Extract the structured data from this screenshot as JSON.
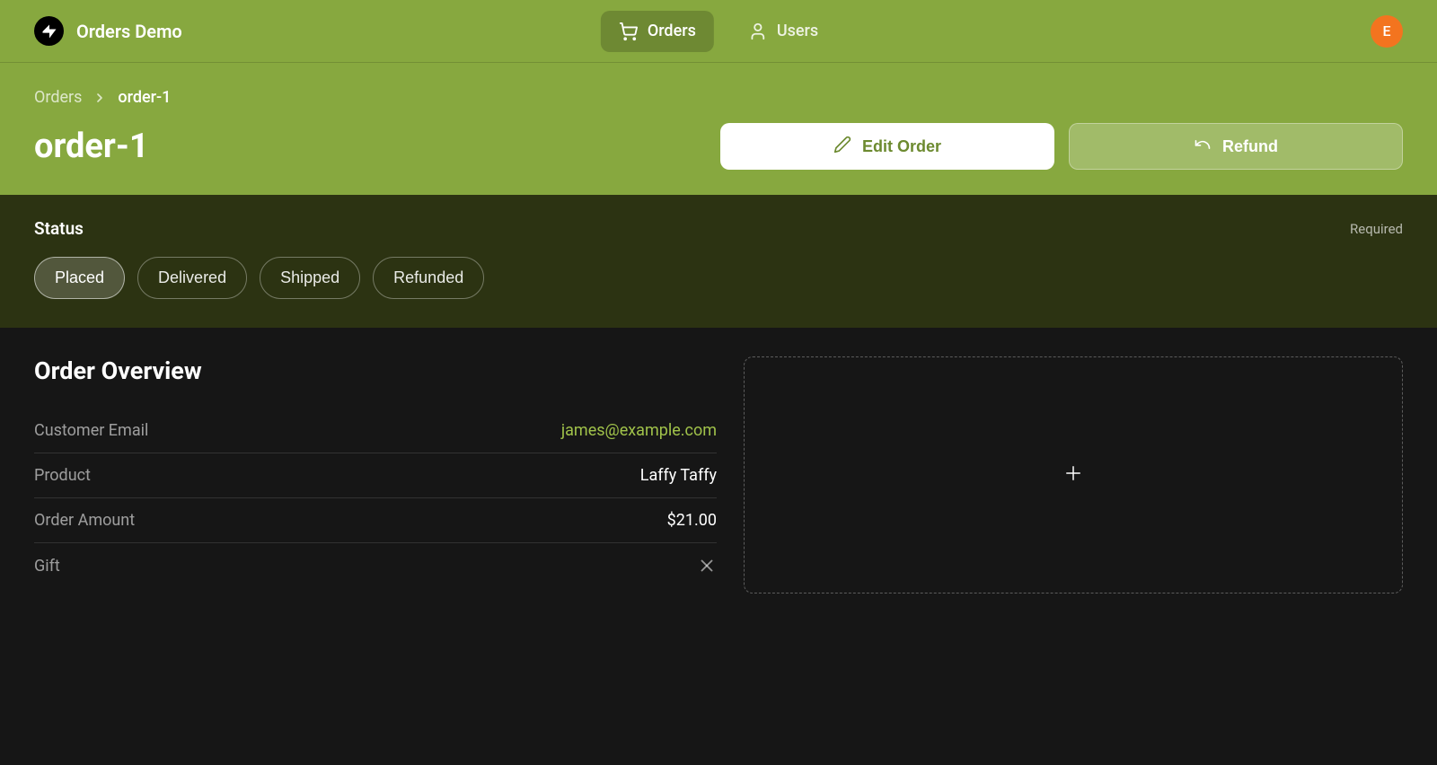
{
  "header": {
    "brand": "Orders Demo",
    "nav": [
      {
        "label": "Orders",
        "active": true
      },
      {
        "label": "Users",
        "active": false
      }
    ],
    "avatar_initial": "E"
  },
  "breadcrumb": {
    "parent": "Orders",
    "current": "order-1"
  },
  "page": {
    "title": "order-1",
    "actions": {
      "edit": "Edit Order",
      "refund": "Refund"
    }
  },
  "status": {
    "label": "Status",
    "required_label": "Required",
    "options": [
      "Placed",
      "Delivered",
      "Shipped",
      "Refunded"
    ],
    "selected": "Placed"
  },
  "overview": {
    "title": "Order Overview",
    "rows": {
      "customer_email": {
        "label": "Customer Email",
        "value": "james@example.com"
      },
      "product": {
        "label": "Product",
        "value": "Laffy Taffy"
      },
      "amount": {
        "label": "Order Amount",
        "value": "$21.00"
      },
      "gift": {
        "label": "Gift"
      }
    }
  }
}
